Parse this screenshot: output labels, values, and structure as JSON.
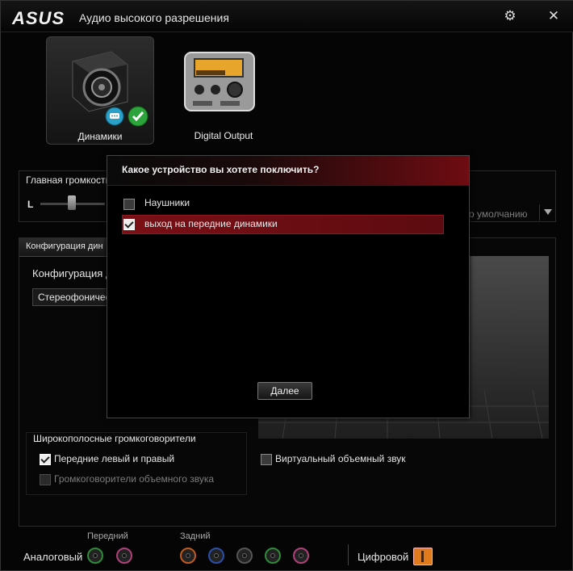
{
  "window": {
    "logo": "ASUS",
    "title": "Аудио высокого разрешения",
    "settings_icon": "gear-icon",
    "close_icon": "close-icon",
    "close_glyph": "✕",
    "settings_glyph": "⚙"
  },
  "devices": [
    {
      "label": "Динамики",
      "icon": "speaker-icon",
      "active": true
    },
    {
      "label": "Digital Output",
      "icon": "digital-output-icon",
      "active": false
    }
  ],
  "volume": {
    "label": "Главная громкость",
    "left_label": "L",
    "default_text": "о умолчанию"
  },
  "config": {
    "tab_label": "Конфигурация дин",
    "section_label": "Конфигурация д",
    "select_value": "Стереофоничес"
  },
  "wideband": {
    "title": "Широкополосные громкоговорители",
    "front_label": "Передние левый и правый",
    "surround_label": "Громкоговорители объемного звука",
    "virtual_label": "Виртуальный объемный звук"
  },
  "dialog": {
    "title": "Какое устройство вы хотете поключить?",
    "options": [
      {
        "label": "Наушники",
        "checked": false
      },
      {
        "label": "выход на передние динамики",
        "checked": true
      }
    ],
    "next_label": "Далее"
  },
  "footer": {
    "front_label": "Передний",
    "rear_label": "Задний",
    "analog_label": "Аналоговый",
    "digital_label": "Цифровой",
    "colors": {
      "jack_green": "#2f8a3a",
      "jack_pink": "#b0407a",
      "jack_orange": "#c05a1e",
      "jack_blue": "#2a4fa8",
      "jack_black": "#333333",
      "digital_orange": "#e07a1c"
    }
  },
  "accent_color": "#8a1a20"
}
